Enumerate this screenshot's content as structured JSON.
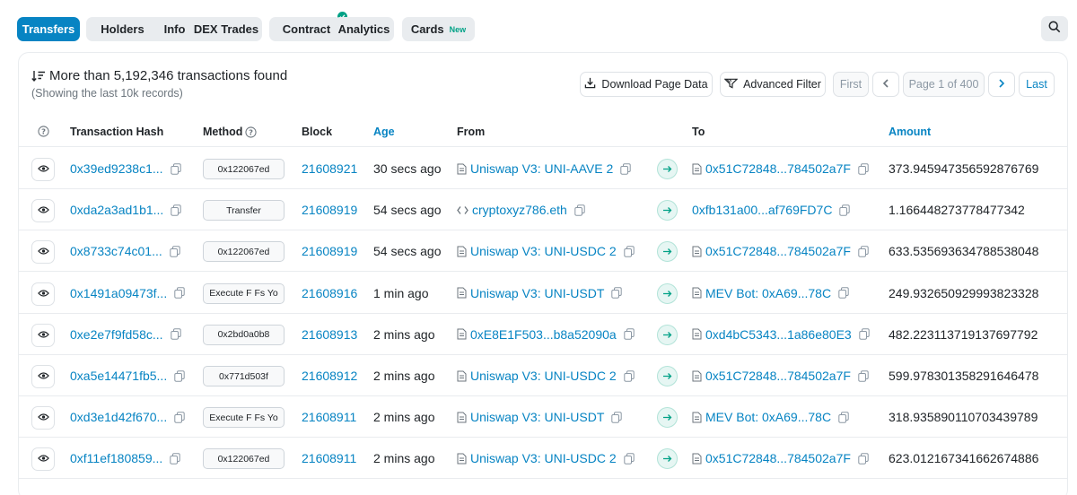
{
  "tabs": [
    {
      "label": "Transfers",
      "active": true
    },
    {
      "label": "Holders"
    },
    {
      "label": "Info"
    },
    {
      "label": "DEX Trades"
    },
    {
      "label": "Contract",
      "verified": true
    },
    {
      "label": "Analytics"
    },
    {
      "label": "Cards",
      "badge": "New"
    }
  ],
  "summary": {
    "title": "More than 5,192,346 transactions found",
    "subtitle": "(Showing the last 10k records)"
  },
  "toolbar": {
    "download": "Download Page Data",
    "filter": "Advanced Filter"
  },
  "pagination": {
    "first": "First",
    "page": "Page 1 of 400",
    "last": "Last"
  },
  "columns": {
    "hash": "Transaction Hash",
    "method": "Method",
    "block": "Block",
    "age": "Age",
    "from": "From",
    "to": "To",
    "amount": "Amount"
  },
  "rows": [
    {
      "hash": "0x39ed9238c1...",
      "method": "0x122067ed",
      "block": "21608921",
      "age": "30 secs ago",
      "from": "Uniswap V3: UNI-AAVE 2",
      "from_type": "contract",
      "to": "0x51C72848...784502a7F",
      "to_type": "contract",
      "amount": "373.945947356592876769"
    },
    {
      "hash": "0xda2a3ad1b1...",
      "method": "Transfer",
      "block": "21608919",
      "age": "54 secs ago",
      "from": "cryptoxyz786.eth",
      "from_type": "ens",
      "to": "0xfb131a00...af769FD7C",
      "to_type": "address",
      "amount": "1.166448273778477342"
    },
    {
      "hash": "0x8733c74c01...",
      "method": "0x122067ed",
      "block": "21608919",
      "age": "54 secs ago",
      "from": "Uniswap V3: UNI-USDC 2",
      "from_type": "contract",
      "to": "0x51C72848...784502a7F",
      "to_type": "contract",
      "amount": "633.535693634788538048"
    },
    {
      "hash": "0x1491a09473f...",
      "method": "Execute F Fs Yo",
      "block": "21608916",
      "age": "1 min ago",
      "from": "Uniswap V3: UNI-USDT",
      "from_type": "contract",
      "to": "MEV Bot: 0xA69...78C",
      "to_type": "contract",
      "amount": "249.932650929993823328"
    },
    {
      "hash": "0xe2e7f9fd58c...",
      "method": "0x2bd0a0b8",
      "block": "21608913",
      "age": "2 mins ago",
      "from": "0xE8E1F503...b8a52090a",
      "from_type": "contract",
      "to": "0xd4bC5343...1a86e80E3",
      "to_type": "contract",
      "amount": "482.223113719137697792"
    },
    {
      "hash": "0xa5e14471fb5...",
      "method": "0x771d503f",
      "block": "21608912",
      "age": "2 mins ago",
      "from": "Uniswap V3: UNI-USDC 2",
      "from_type": "contract",
      "to": "0x51C72848...784502a7F",
      "to_type": "contract",
      "amount": "599.978301358291646478"
    },
    {
      "hash": "0xd3e1d42f670...",
      "method": "Execute F Fs Yo",
      "block": "21608911",
      "age": "2 mins ago",
      "from": "Uniswap V3: UNI-USDT",
      "from_type": "contract",
      "to": "MEV Bot: 0xA69...78C",
      "to_type": "contract",
      "amount": "318.935890110703439789"
    },
    {
      "hash": "0xf11ef180859...",
      "method": "0x122067ed",
      "block": "21608911",
      "age": "2 mins ago",
      "from": "Uniswap V3: UNI-USDC 2",
      "from_type": "contract",
      "to": "0x51C72848...784502a7F",
      "to_type": "contract",
      "amount": "623.012167341662674886"
    }
  ],
  "icons": {
    "search": "search-icon",
    "eye": "eye-icon",
    "copy": "copy-icon",
    "doc": "document-icon",
    "ens": "code-icon",
    "arrow": "arrow-right-icon"
  },
  "colors": {
    "accent": "#0784c3",
    "success": "#00a186",
    "muted": "#6c757d"
  }
}
